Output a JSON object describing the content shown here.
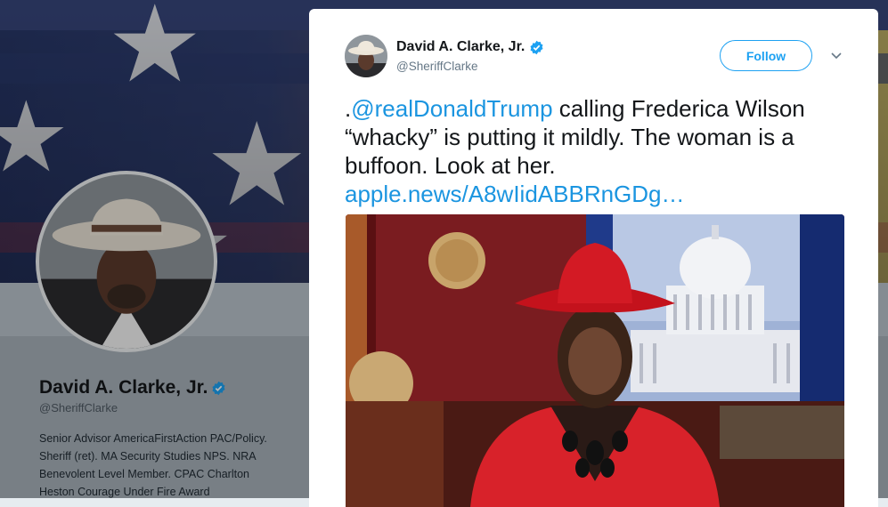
{
  "profile": {
    "name": "David A. Clarke, Jr.",
    "handle": "@SheriffClarke",
    "bio_lines": [
      "Senior Advisor AmericaFirstAction PAC/Policy.",
      "Sheriff (ret). MA Security Studies NPS. NRA",
      "Benevolent Level Member. CPAC Charlton",
      "Heston Courage Under Fire Award"
    ]
  },
  "tweet": {
    "author_name": "David A. Clarke, Jr.",
    "author_handle": "@SheriffClarke",
    "follow_label": "Follow",
    "text_prefix": ".",
    "mention": "@realDonaldTrump",
    "text_line1_rest": " calling Frederica Wilson",
    "text_line2": "“whacky” is putting it mildly. The woman is a",
    "text_line3": "buffoon. Look at her.",
    "link": "apple.news/A8wIidABBRnGDg…",
    "media_icon": "news-video-still"
  },
  "icons": {
    "verified": "verified-badge-icon",
    "caret": "chevron-down-icon"
  },
  "colors": {
    "accent": "#1da1f2",
    "link": "#1b95e0",
    "text": "#14171a",
    "muted": "#657786"
  }
}
